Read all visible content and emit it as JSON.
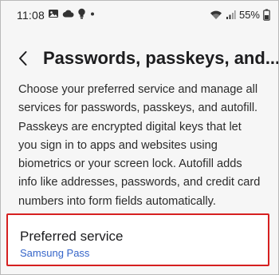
{
  "status_bar": {
    "time": "11:08",
    "left_icons": [
      "image-icon",
      "cloud-icon",
      "bulb-icon",
      "dot-icon"
    ],
    "right_icons": [
      "wifi-icon",
      "signal-icon"
    ],
    "battery": "55%"
  },
  "header": {
    "back_icon": "back-arrow-icon",
    "title": "Passwords, passkeys, and..."
  },
  "description": "Choose your preferred service and manage all services for passwords, passkeys, and autofill. Passkeys are encrypted digital keys that let you sign in to apps and websites using biometrics or your screen lock. Autofill adds info like addresses, passwords, and credit card numbers into form fields automatically.",
  "preferred_service": {
    "title": "Preferred service",
    "value": "Samsung Pass",
    "highlight_color": "#d62020",
    "value_color": "#3565c9"
  }
}
